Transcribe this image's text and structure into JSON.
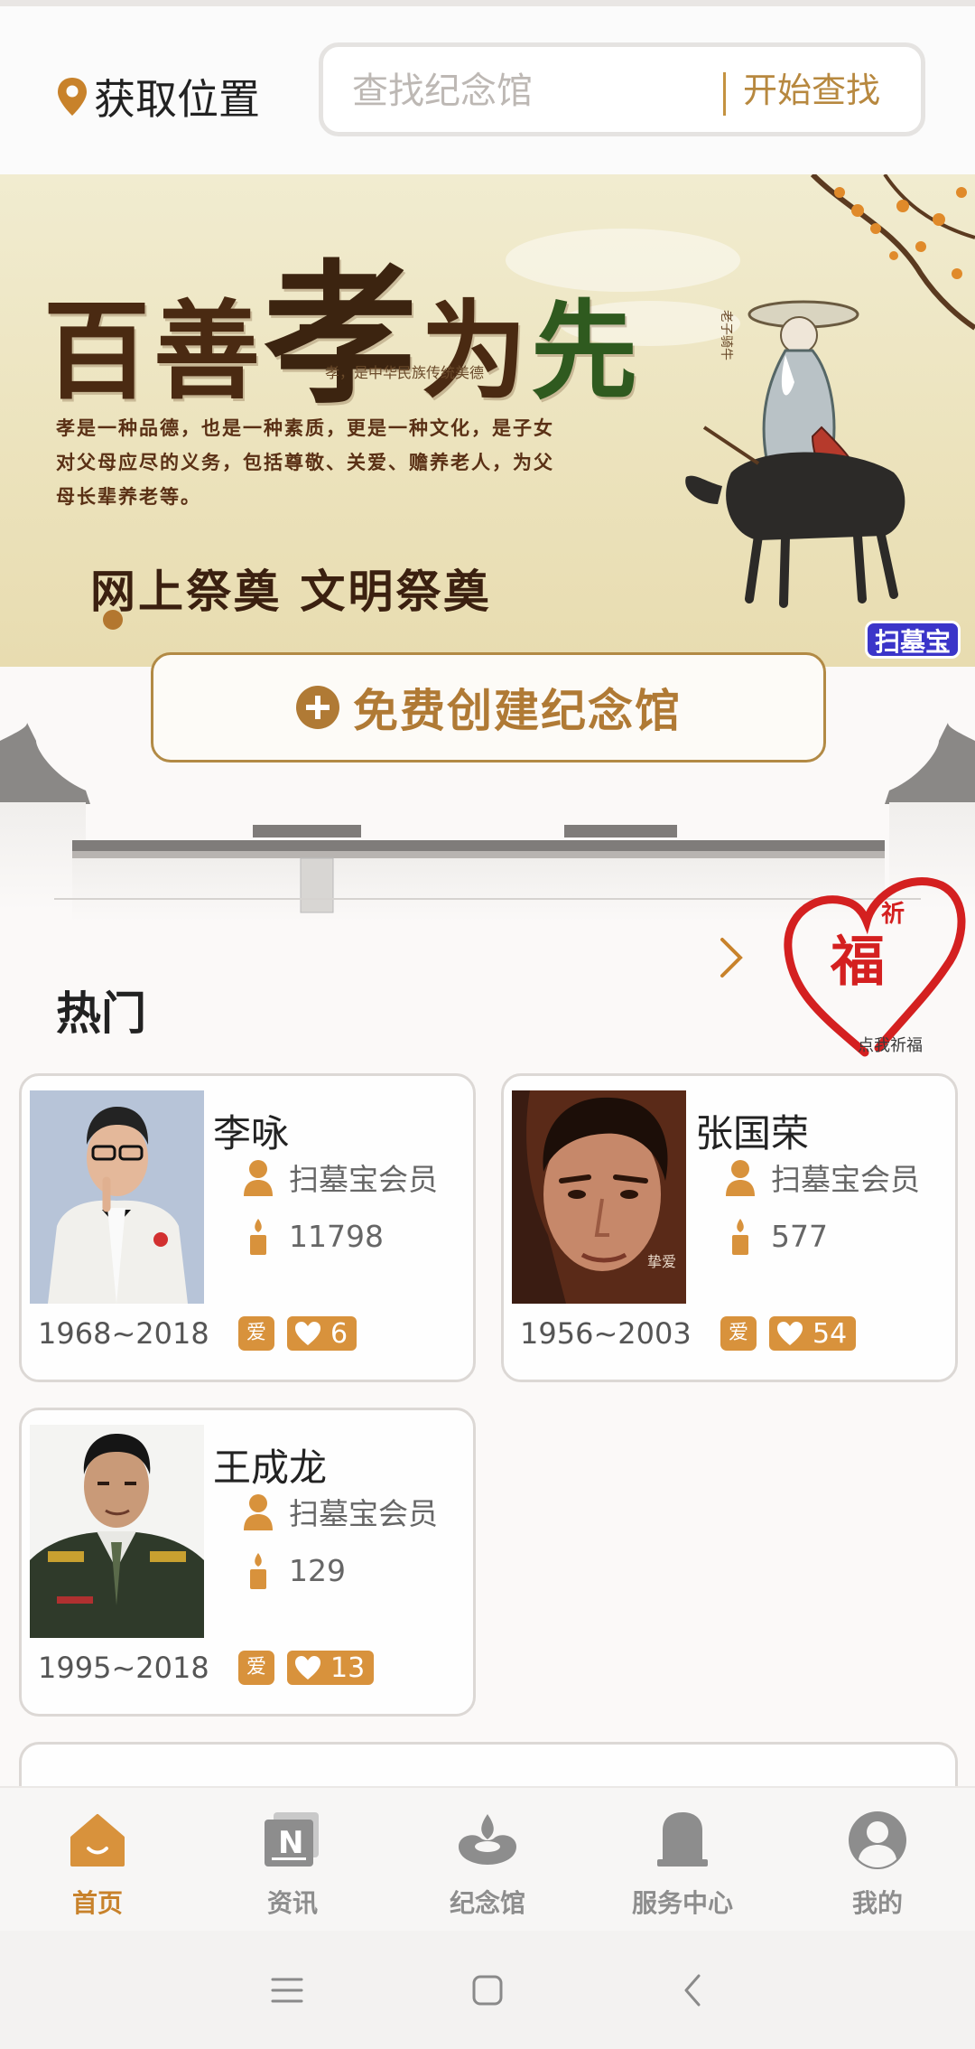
{
  "header": {
    "location_label": "获取位置",
    "search_placeholder": "查找纪念馆",
    "search_button": "开始查找"
  },
  "banner": {
    "title_part1": "百善",
    "title_part2": "孝",
    "title_part3": "为",
    "title_part4": "先",
    "subtitle": "孝，是中华民族传统美德",
    "description": "孝是一种品德，也是一种素质，更是一种文化，是子女对父母应尽的义务，包括尊敬、关爱、赡养老人，为父母长辈养老等。",
    "slogan": "网上祭奠 文明祭奠",
    "brand": "扫墓宝"
  },
  "create_button": "免费创建纪念馆",
  "hot": {
    "title": "热门",
    "blessing_char": "福",
    "blessing_small": "祈",
    "blessing_label": "点我祈福"
  },
  "memorials": [
    {
      "name": "李咏",
      "member": "扫墓宝会员",
      "candles": "11798",
      "years": "1968~2018",
      "love_tag": "爱",
      "likes": "6"
    },
    {
      "name": "张国荣",
      "member": "扫墓宝会员",
      "candles": "577",
      "years": "1956~2003",
      "love_tag": "爱",
      "likes": "54"
    },
    {
      "name": "王成龙",
      "member": "扫墓宝会员",
      "candles": "129",
      "years": "1995~2018",
      "love_tag": "爱",
      "likes": "13"
    }
  ],
  "bottom_nav": [
    {
      "label": "首页",
      "icon": "home-icon",
      "active": true
    },
    {
      "label": "资讯",
      "icon": "news-icon",
      "active": false
    },
    {
      "label": "纪念馆",
      "icon": "memorial-icon",
      "active": false
    },
    {
      "label": "服务中心",
      "icon": "tombstone-icon",
      "active": false
    },
    {
      "label": "我的",
      "icon": "profile-icon",
      "active": false
    }
  ],
  "colors": {
    "accent": "#c8822b",
    "tag": "#d8923c",
    "border": "#dcd8d5",
    "background": "#fbf9f8"
  }
}
